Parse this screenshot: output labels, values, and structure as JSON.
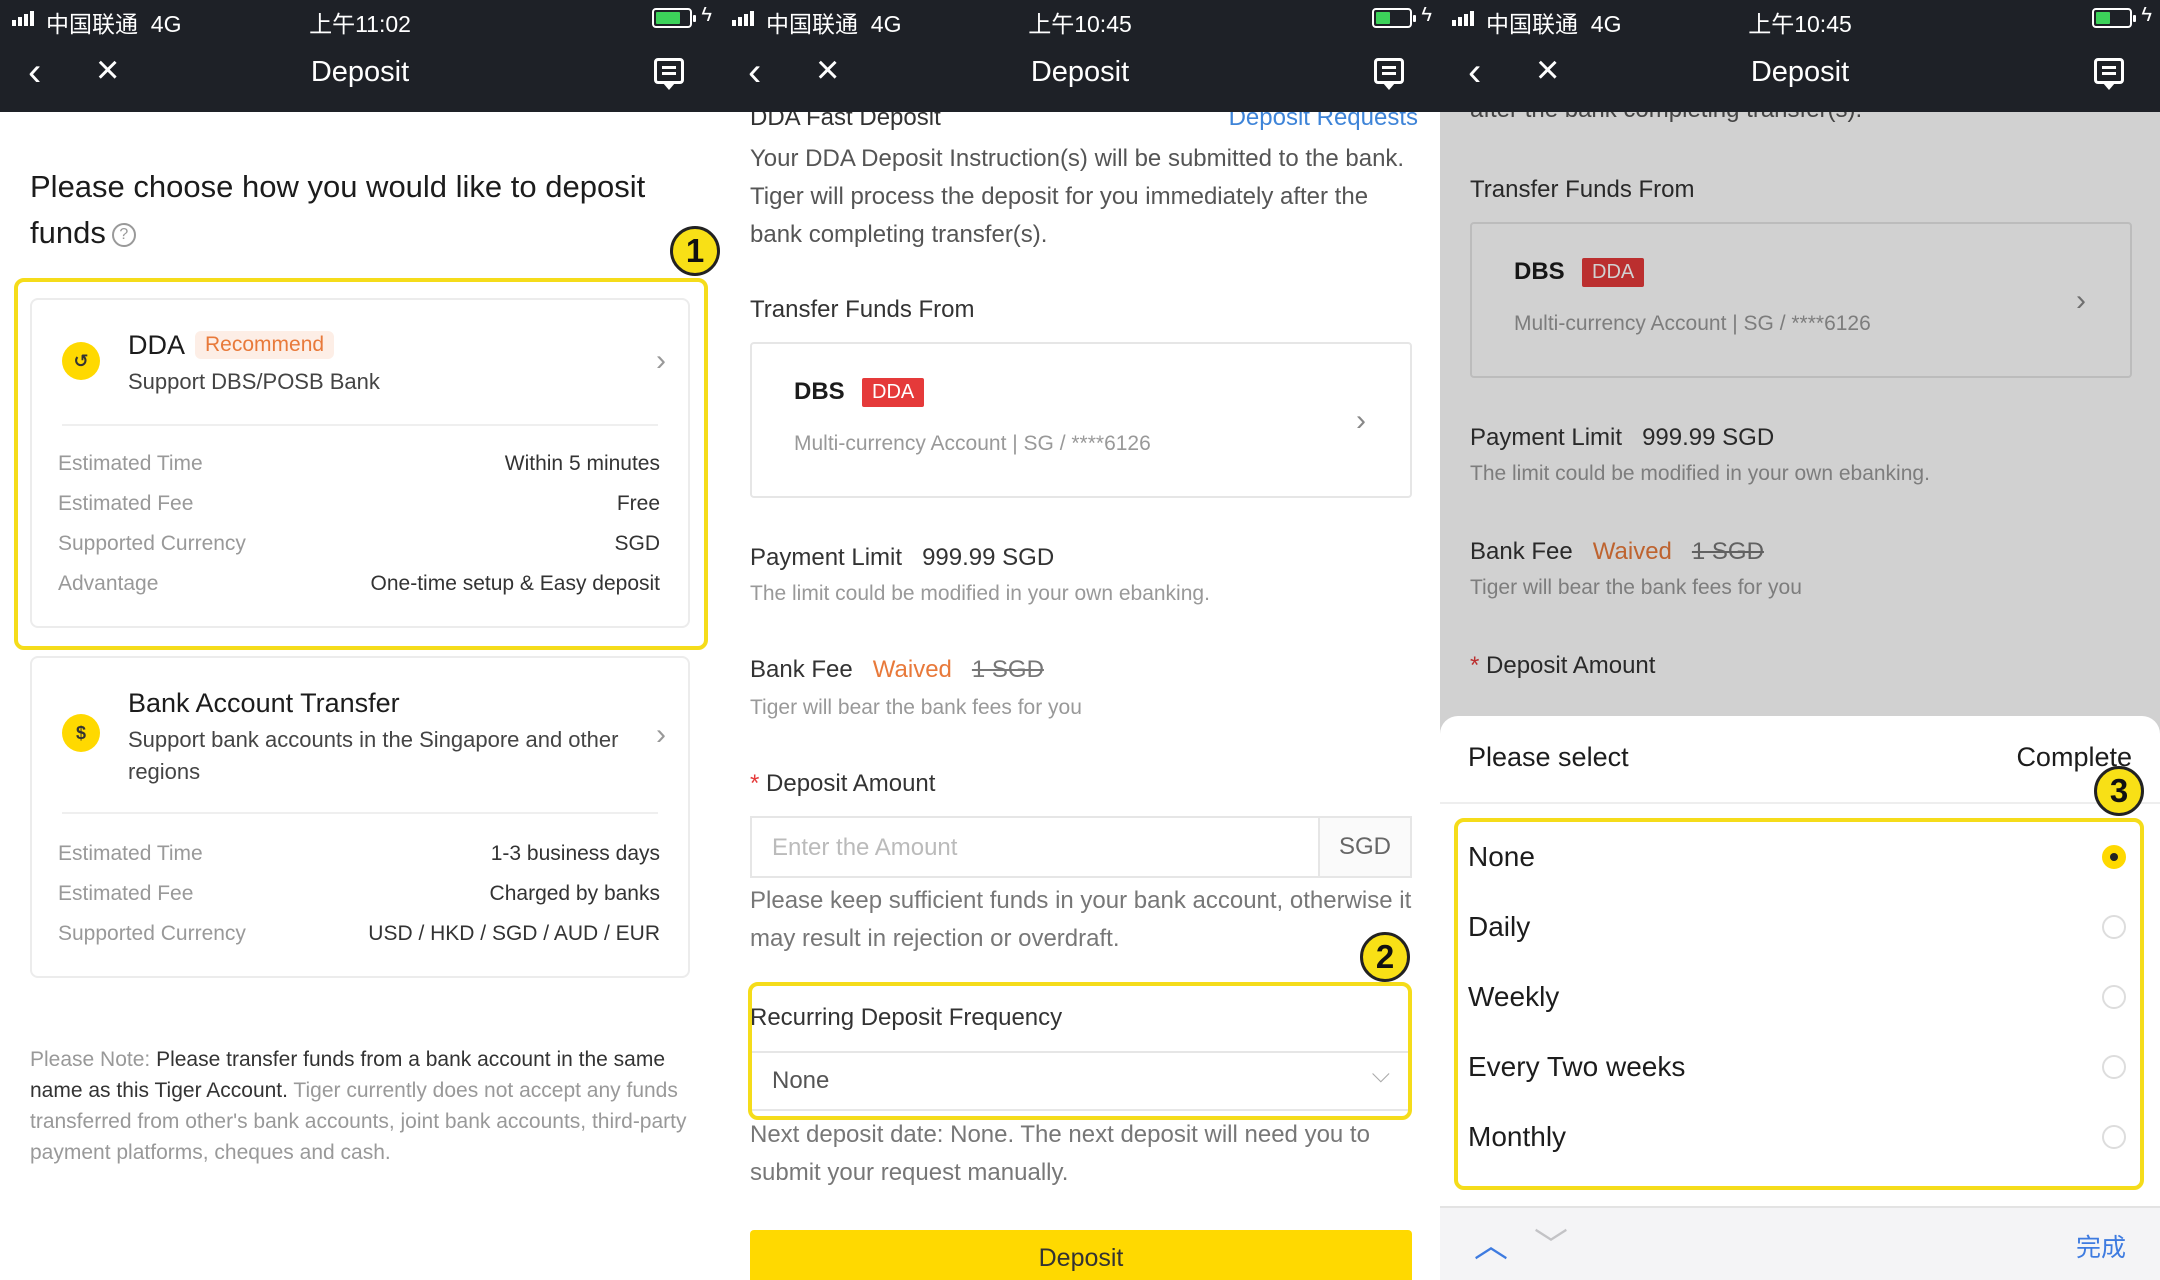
{
  "statusbar": [
    {
      "carrier": "中国联通",
      "network": "4G",
      "time": "上午11:02",
      "battery_level": 0.75
    },
    {
      "carrier": "中国联通",
      "network": "4G",
      "time": "上午10:45",
      "battery_level": 0.45
    },
    {
      "carrier": "中国联通",
      "network": "4G",
      "time": "上午10:45",
      "battery_level": 0.45
    }
  ],
  "nav": {
    "title": "Deposit",
    "back_icon": "chevron-left-icon",
    "close_icon": "close-icon",
    "message_icon": "message-icon"
  },
  "screen1": {
    "heading": "Please choose how you would like to deposit funds",
    "help_glyph": "?",
    "dda": {
      "coin": "↺",
      "title": "DDA",
      "tag": "Recommend",
      "subtitle": "Support DBS/POSB Bank",
      "rows": [
        {
          "k": "Estimated Time",
          "v": "Within 5 minutes"
        },
        {
          "k": "Estimated Fee",
          "v": "Free"
        },
        {
          "k": "Supported Currency",
          "v": "SGD"
        },
        {
          "k": "Advantage",
          "v": "One-time setup & Easy deposit"
        }
      ]
    },
    "bank": {
      "coin": "$",
      "title": "Bank Account Transfer",
      "subtitle": "Support bank accounts in the Singapore and other regions",
      "rows": [
        {
          "k": "Estimated Time",
          "v": "1-3 business days"
        },
        {
          "k": "Estimated Fee",
          "v": "Charged by banks"
        },
        {
          "k": "Supported Currency",
          "v": "USD / HKD / SGD / AUD / EUR"
        }
      ]
    },
    "note": {
      "label": "Please Note: ",
      "dark1": "Please transfer funds from a bank account in the same name as this Tiger Account.",
      "rest": " Tiger currently does not accept any funds transferred from other's bank accounts, joint bank accounts, third-party payment platforms, cheques and cash."
    },
    "badge": "1"
  },
  "screen2": {
    "section_title": "DDA Fast Deposit",
    "requests_link": "Deposit Requests",
    "desc": "Your DDA Deposit Instruction(s) will be submitted to the bank. Tiger will process the deposit for you immediately after the bank completing transfer(s).",
    "transfer_from": "Transfer Funds From",
    "bank_name": "DBS",
    "bank_tag": "DDA",
    "account": "Multi-currency Account  |  SG / ****6126",
    "payment_limit_label": "Payment Limit",
    "payment_limit_value": "999.99 SGD",
    "limit_note": "The limit could be modified in your own ebanking.",
    "bank_fee_label": "Bank Fee",
    "waived": "Waived",
    "orig_fee": "1 SGD",
    "fee_note": "Tiger will bear the bank fees for you",
    "required_mark": "*",
    "amount_label": "Deposit Amount",
    "amount_placeholder": "Enter the Amount",
    "currency": "SGD",
    "keep_note": "Please keep sufficient funds in your bank account, otherwise it may result in rejection or overdraft.",
    "freq_label": "Recurring Deposit Frequency",
    "freq_value": "None",
    "next_note": "Next deposit date: None. The next deposit will need you to submit your request manually.",
    "deposit_button": "Deposit",
    "badge": "2"
  },
  "screen3": {
    "top_partial": "after the bank completing transfer(s).",
    "transfer_from": "Transfer Funds From",
    "bank_name": "DBS",
    "bank_tag": "DDA",
    "account": "Multi-currency Account  |  SG / ****6126",
    "payment_limit_label": "Payment Limit",
    "payment_limit_value": "999.99 SGD",
    "limit_note": "The limit could be modified in your own ebanking.",
    "bank_fee_label": "Bank Fee",
    "waived": "Waived",
    "orig_fee": "1 SGD",
    "fee_note": "Tiger will bear the bank fees for you",
    "required_mark": "*",
    "amount_label": "Deposit Amount",
    "picker_title": "Please select",
    "picker_complete": "Complete",
    "options": [
      "None",
      "Daily",
      "Weekly",
      "Every Two weeks",
      "Monthly"
    ],
    "selected": "None",
    "kb_done": "完成",
    "badge": "3"
  },
  "colors": {
    "accent": "#ffd900",
    "highlight": "#f5dc1a",
    "link": "#3e84d8",
    "danger": "#e53a3a",
    "waived": "#e8793a",
    "navbar": "#1e2127"
  }
}
